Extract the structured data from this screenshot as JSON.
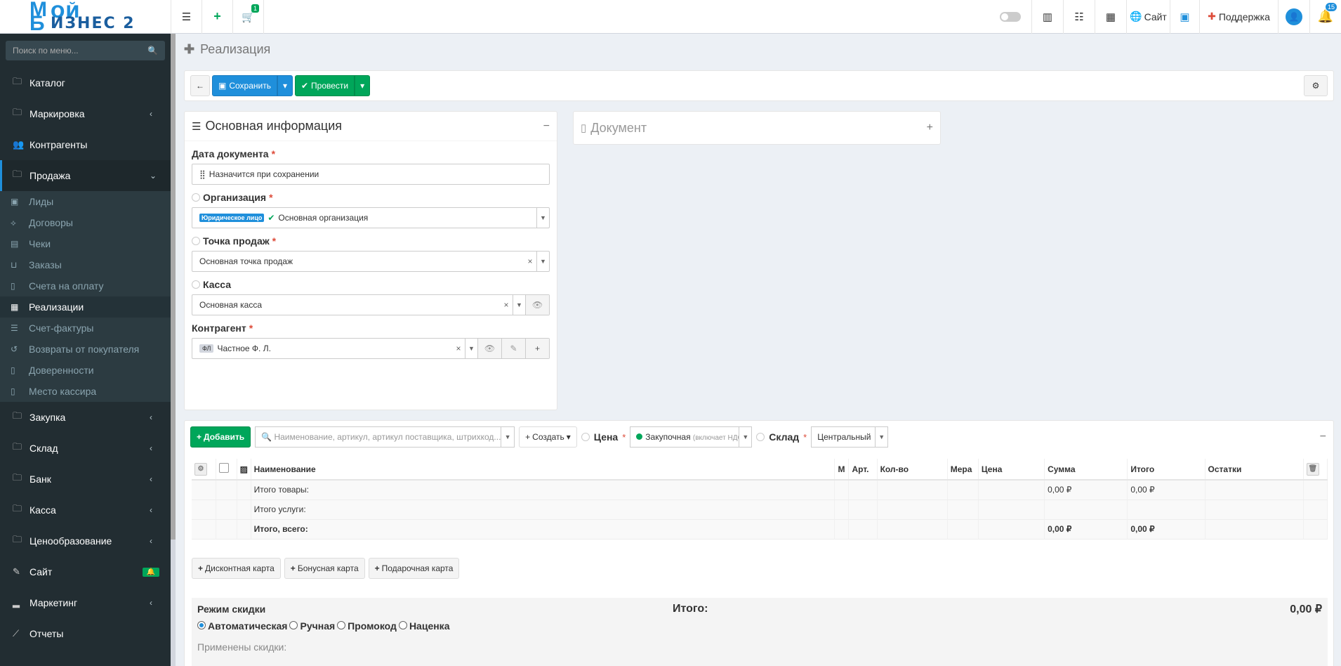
{
  "logo": {
    "line1": "ОЙ",
    "line2": "ИЗНЕС 2"
  },
  "topbar": {
    "cart_badge": "1",
    "site_label": "Сайт",
    "support_label": "Поддержка",
    "notif_badge": "15"
  },
  "sidebar": {
    "search_placeholder": "Поиск по меню...",
    "items": [
      {
        "label": "Каталог"
      },
      {
        "label": "Маркировка",
        "arrow": "‹"
      },
      {
        "label": "Контрагенты"
      },
      {
        "label": "Продажа",
        "arrow": "⌄"
      }
    ],
    "sub": [
      {
        "label": "Лиды"
      },
      {
        "label": "Договоры"
      },
      {
        "label": "Чеки"
      },
      {
        "label": "Заказы"
      },
      {
        "label": "Счета на оплату"
      },
      {
        "label": "Реализации"
      },
      {
        "label": "Счет-фактуры"
      },
      {
        "label": "Возвраты от покупателя"
      },
      {
        "label": "Доверенности"
      },
      {
        "label": "Место кассира"
      }
    ],
    "items2": [
      {
        "label": "Закупка",
        "arrow": "‹"
      },
      {
        "label": "Склад",
        "arrow": "‹"
      },
      {
        "label": "Банк",
        "arrow": "‹"
      },
      {
        "label": "Касса",
        "arrow": "‹"
      },
      {
        "label": "Ценообразование",
        "arrow": "‹"
      },
      {
        "label": "Сайт"
      },
      {
        "label": "Маркетинг",
        "arrow": "‹"
      },
      {
        "label": "Отчеты"
      }
    ]
  },
  "page": {
    "title": "Реализация"
  },
  "toolbar": {
    "save_label": "Сохранить",
    "post_label": "Провести"
  },
  "main_info": {
    "title": "Основная информация",
    "date_label": "Дата документа",
    "date_value": "Назначится при сохранении",
    "org_label": "Организация",
    "org_tag": "Юридическое лицо",
    "org_value": "Основная организация",
    "pos_label": "Точка продаж",
    "pos_value": "Основная точка продаж",
    "cash_label": "Касса",
    "cash_value": "Основная касса",
    "contr_label": "Контрагент",
    "contr_tag": "ФЛ",
    "contr_value": "Частное Ф. Л."
  },
  "document_box": {
    "title": "Документ"
  },
  "products": {
    "add_label": "Добавить",
    "search_placeholder": "Наименование, артикул, артикул поставщика, штрихкод...",
    "create_label": "Создать",
    "price_label": "Цена",
    "price_value": "Закупочная",
    "price_note": "(включает НДС)",
    "warehouse_label": "Склад",
    "warehouse_value": "Центральный",
    "columns": [
      "Наименование",
      "М",
      "Арт.",
      "Кол-во",
      "Мера",
      "Цена",
      "Сумма",
      "Итого",
      "Остатки"
    ],
    "rows": [
      {
        "name": "Итого товары:",
        "sum": "0,00 ₽",
        "total": "0,00 ₽"
      },
      {
        "name": "Итого услуги:",
        "sum": "",
        "total": ""
      },
      {
        "name": "Итого, всего:",
        "sum": "0,00 ₽",
        "total": "0,00 ₽"
      }
    ],
    "card_buttons": [
      "Дисконтная карта",
      "Бонусная карта",
      "Подарочная карта"
    ]
  },
  "discount": {
    "mode_label": "Режим скидки",
    "total_label": "Итого:",
    "total_value": "0,00 ₽",
    "options": [
      "Автоматическая",
      "Ручная",
      "Промокод",
      "Наценка"
    ],
    "applied_label": "Применены скидки:"
  }
}
